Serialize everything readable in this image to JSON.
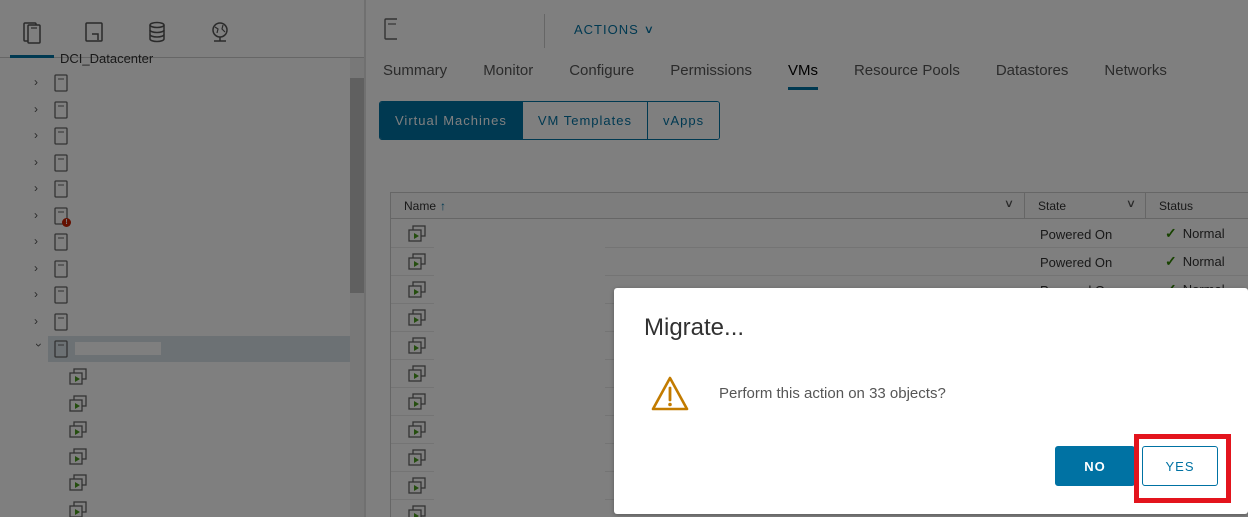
{
  "navigator": {
    "tabs": [
      {
        "icon": "hosts-and-clusters-icon",
        "active": true
      },
      {
        "icon": "vms-and-templates-icon",
        "active": false
      },
      {
        "icon": "storage-icon",
        "active": false
      },
      {
        "icon": "networking-icon",
        "active": false
      }
    ],
    "datacenter_label": "DCI_Datacenter"
  },
  "object": {
    "actions_label": "ACTIONS"
  },
  "tabs": [
    "Summary",
    "Monitor",
    "Configure",
    "Permissions",
    "VMs",
    "Resource Pools",
    "Datastores",
    "Networks"
  ],
  "active_tab": "VMs",
  "segments": [
    "Virtual Machines",
    "VM Templates",
    "vApps"
  ],
  "active_segment": "Virtual Machines",
  "grid": {
    "columns": {
      "name": "Name",
      "state": "State",
      "status": "Status"
    },
    "rows": [
      {
        "state": "Powered On",
        "status": "Normal"
      },
      {
        "state": "Powered On",
        "status": "Normal"
      },
      {
        "state": "Powered On",
        "status": "Normal"
      }
    ]
  },
  "dialog": {
    "title": "Migrate...",
    "message": "Perform this action on 33 objects?",
    "no_label": "NO",
    "yes_label": "YES"
  },
  "colors": {
    "accent": "#0072a3",
    "highlight": "#e3141d",
    "warning": "#c27b00"
  }
}
